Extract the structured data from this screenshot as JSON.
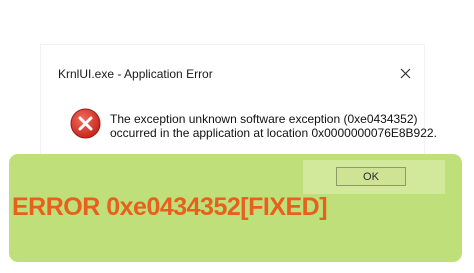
{
  "dialog": {
    "title": "KrnlUI.exe - Application Error",
    "message_line1": "The exception unknown software exception (0xe0434352)",
    "message_line2": "occurred in the application at location 0x0000000076E8B922.",
    "ok_label": "OK",
    "close_icon": "close-icon",
    "error_icon": "error-x-icon"
  },
  "banner": {
    "headline": "ERROR 0xe0434352[FIXED]"
  },
  "colors": {
    "overlay": "#bfdf7a",
    "headline": "#e8601c",
    "error_red": "#d9352b"
  }
}
